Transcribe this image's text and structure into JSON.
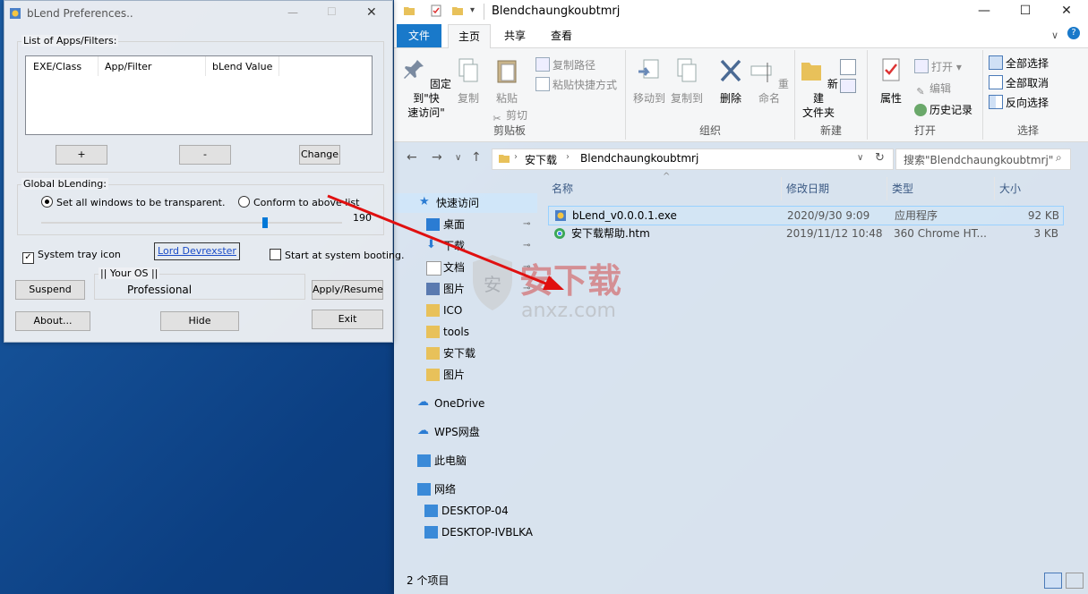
{
  "blend": {
    "title": "bLend Preferences..",
    "list_legend": "List of Apps/Filters:",
    "columns": [
      "EXE/Class",
      "App/Filter",
      "bLend Value"
    ],
    "add_label": "+",
    "remove_label": "-",
    "change_label": "Change",
    "global_legend": "Global bLending:",
    "radio_all": "Set all windows to be transparent.",
    "radio_conform": "Conform to above list",
    "slider_value": "190",
    "slider_fraction": 0.745,
    "tray_label": "System tray icon",
    "tray_checked": true,
    "author_link": "Lord Devrexster",
    "startup_label": "Start at system booting.",
    "startup_checked": false,
    "os_legend": "|| Your OS ||",
    "os_value": "Professional",
    "suspend_label": "Suspend",
    "apply_label": "Apply/Resume",
    "about_label": "About...",
    "hide_label": "Hide",
    "exit_label": "Exit"
  },
  "explorer": {
    "title": "Blendchaungkoubtmrj",
    "tabs": [
      "文件",
      "主页",
      "共享",
      "查看"
    ],
    "ribbon": {
      "pin_label": "固定到\"快\n速访问\"",
      "copy_label": "复制",
      "paste_label": "粘贴",
      "copy_path": "复制路径",
      "paste_shortcut": "粘贴快捷方式",
      "cut": "剪切",
      "group_clipboard": "剪贴板",
      "move_to": "移动到",
      "copy_to": "复制到",
      "delete": "删除",
      "rename": "重命名",
      "group_organize": "组织",
      "new_folder": "新建\n文件夹",
      "group_new": "新建",
      "properties": "属性",
      "open": "打开",
      "edit": "编辑",
      "history": "历史记录",
      "group_open": "打开",
      "select_all": "全部选择",
      "select_none": "全部取消",
      "invert": "反向选择",
      "group_select": "选择"
    },
    "address": {
      "crumbs": [
        "安下载",
        "Blendchaungkoubtmrj"
      ],
      "search_placeholder": "搜索\"Blendchaungkoubtmrj\""
    },
    "nav": [
      {
        "label": "快速访问",
        "icon": "star-icon"
      },
      {
        "label": "桌面",
        "icon": "desktop-icon",
        "pinned": true
      },
      {
        "label": "下载",
        "icon": "download-icon",
        "pinned": true
      },
      {
        "label": "文档",
        "icon": "document-icon",
        "pinned": true
      },
      {
        "label": "图片",
        "icon": "picture-icon",
        "pinned": true
      },
      {
        "label": "ICO",
        "icon": "folder-icon"
      },
      {
        "label": "tools",
        "icon": "folder-icon"
      },
      {
        "label": "安下载",
        "icon": "folder-icon"
      },
      {
        "label": "图片",
        "icon": "folder-icon"
      },
      {
        "label": "OneDrive",
        "icon": "cloud-icon"
      },
      {
        "label": "WPS网盘",
        "icon": "cloud-icon"
      },
      {
        "label": "此电脑",
        "icon": "computer-icon"
      },
      {
        "label": "网络",
        "icon": "network-icon"
      },
      {
        "label": "DESKTOP-04",
        "icon": "computer-icon"
      },
      {
        "label": "DESKTOP-IVBLKA",
        "icon": "computer-icon"
      }
    ],
    "columns": [
      "名称",
      "修改日期",
      "类型",
      "大小"
    ],
    "files": [
      {
        "name": "bLend_v0.0.0.1.exe",
        "date": "2020/9/30 9:09",
        "type": "应用程序",
        "size": "92 KB"
      },
      {
        "name": "安下载帮助.htm",
        "date": "2019/11/12 10:48",
        "type": "360 Chrome HT...",
        "size": "3 KB"
      }
    ],
    "status": "2 个项目"
  },
  "watermark": {
    "text": "安下载",
    "sub": "anxz.com"
  },
  "colors": {
    "accent": "#1979ca",
    "arrow": "#e01010"
  }
}
